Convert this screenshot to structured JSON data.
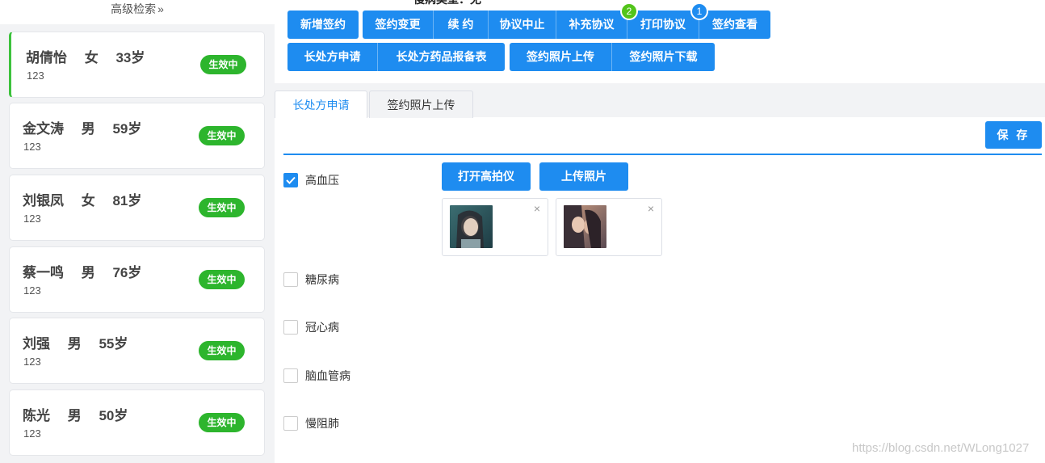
{
  "sidebar": {
    "advanced_search": "高级检索",
    "advanced_search_chevron": "»",
    "patients": [
      {
        "name": "胡倩怡　 女　 33岁",
        "id": "123",
        "status": "生效中"
      },
      {
        "name": "金文涛　 男　 59岁",
        "id": "123",
        "status": "生效中"
      },
      {
        "name": "刘银凤　 女　 81岁",
        "id": "123",
        "status": "生效中"
      },
      {
        "name": "蔡一鸣　 男　 76岁",
        "id": "123",
        "status": "生效中"
      },
      {
        "name": "刘强　 男　 55岁",
        "id": "123",
        "status": "生效中"
      },
      {
        "name": "陈光　 男　 50岁",
        "id": "123",
        "status": "生效中"
      }
    ]
  },
  "toolbar": {
    "disease_type_label": "慢病类型：无",
    "row1_single": "新增签约",
    "row1_group": [
      "签约变更",
      "续 约",
      "协议中止",
      "补充协议",
      "打印协议",
      "签约查看"
    ],
    "badge_print": "2",
    "badge_view": "1",
    "row2_group1": [
      "长处方申请",
      "长处方药品报备表"
    ],
    "row2_group2": [
      "签约照片上传",
      "签约照片下载"
    ]
  },
  "tabs": [
    "长处方申请",
    "签约照片上传"
  ],
  "save_label": "保 存",
  "diseases": [
    {
      "label": "高血压",
      "checked": true
    },
    {
      "label": "糖尿病",
      "checked": false
    },
    {
      "label": "冠心病",
      "checked": false
    },
    {
      "label": "脑血管病",
      "checked": false
    },
    {
      "label": "慢阻肺",
      "checked": false
    }
  ],
  "photo_actions": {
    "open_camera": "打开高拍仪",
    "upload": "上传照片"
  },
  "photo_close": "×",
  "watermark": "https://blog.csdn.net/WLong1027",
  "colors": {
    "primary": "#1e8cf0",
    "status_green": "#2db52d",
    "active_border": "#3cc23c",
    "badge_green": "#52c41a"
  }
}
